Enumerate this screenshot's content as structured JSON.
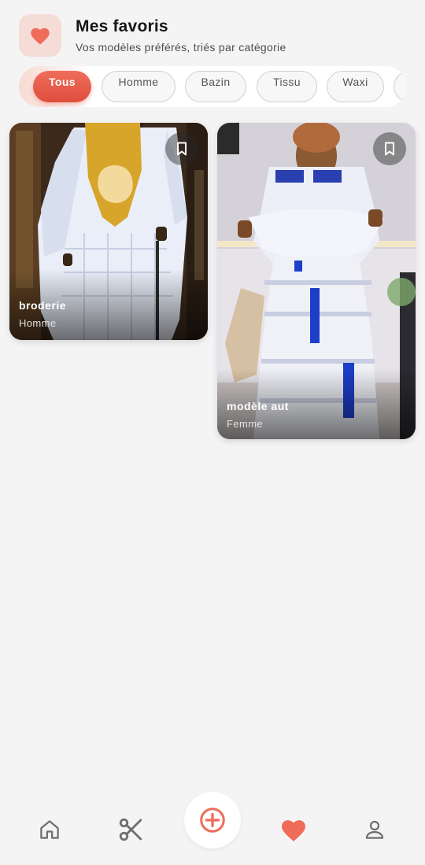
{
  "header": {
    "title": "Mes favoris",
    "subtitle": "Vos modèles préférés, triés par catégorie",
    "icon": "heart-icon"
  },
  "filters": {
    "chips": [
      {
        "label": "Tous",
        "active": true
      },
      {
        "label": "Homme",
        "active": false
      },
      {
        "label": "Bazin",
        "active": false
      },
      {
        "label": "Tissu",
        "active": false
      },
      {
        "label": "Waxi",
        "active": false
      },
      {
        "label": "",
        "active": false
      }
    ]
  },
  "favorites": [
    {
      "title": "broderie",
      "category": "Homme",
      "bookmark_icon": "bookmark-icon"
    },
    {
      "title": "modèle aut",
      "category": "Femme",
      "bookmark_icon": "bookmark-icon"
    }
  ],
  "bottom_nav": {
    "items": [
      {
        "icon": "home-icon",
        "active": false
      },
      {
        "icon": "scissors-icon",
        "active": false
      },
      {
        "icon": "add-circle-icon",
        "active": false
      },
      {
        "icon": "heart-icon",
        "active": true
      },
      {
        "icon": "profile-icon",
        "active": false
      }
    ]
  },
  "colors": {
    "accent": "#ef6b5a",
    "background": "#f4f4f4",
    "badge_background": "#f6dcd6",
    "inactive_icon": "#6e6e6e"
  }
}
